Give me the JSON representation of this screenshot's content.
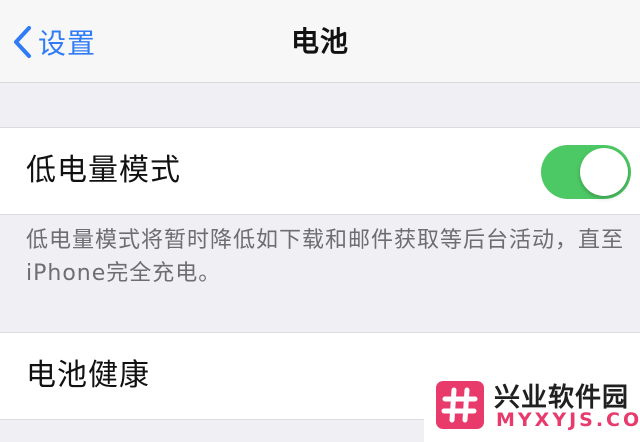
{
  "navbar": {
    "back_label": "设置",
    "title": "电池"
  },
  "low_power_mode": {
    "label": "低电量模式",
    "toggle_on": true,
    "toggle_color": "#4cc964",
    "description": "低电量模式将暂时降低如下载和邮件获取等后台活动，直至iPhone完全充电。"
  },
  "battery_health": {
    "label": "电池健康"
  },
  "watermark": {
    "site_name": "兴业软件园",
    "domain": "MYXYJS.COM",
    "brand_color": "#e83a6b"
  },
  "icons": {
    "back": "chevron-left-icon",
    "logo": "hash-logo-icon"
  },
  "colors": {
    "accent": "#2f7cf6",
    "background": "#efeff4"
  }
}
